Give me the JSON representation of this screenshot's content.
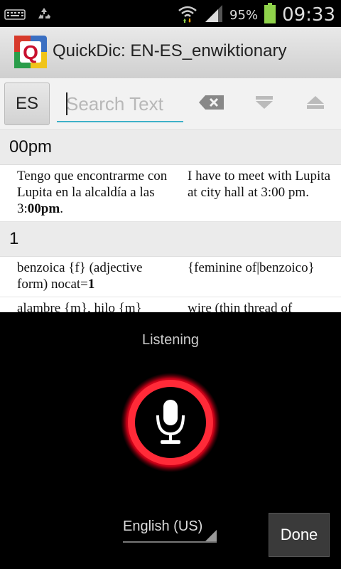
{
  "status_bar": {
    "battery_percent": "95%",
    "time": "09:33",
    "icons": [
      "keyboard-icon",
      "recycle-icon",
      "wifi-icon",
      "signal-icon",
      "battery-icon"
    ]
  },
  "title_bar": {
    "title": "QuickDic: EN-ES_enwiktionary",
    "app_icon_letter": "Q"
  },
  "toolbar": {
    "lang_button": "ES",
    "search_placeholder": "Search Text",
    "icons": [
      "backspace-icon",
      "arrow-down-icon",
      "arrow-up-icon"
    ]
  },
  "results": {
    "sections": [
      {
        "heading": "00pm",
        "entries": [
          {
            "left_pre": "Tengo que encontrarme con Lupita en la alcaldía a las 3:",
            "left_bold": "00pm",
            "left_post": ".",
            "right": "I have to meet with Lupita at city hall at 3:00 pm."
          }
        ]
      },
      {
        "heading": "1",
        "entries": [
          {
            "left_pre": "benzoica {f} (adjective form) nocat=",
            "left_bold": "1",
            "left_post": "",
            "right": "{feminine of|benzoico}"
          },
          {
            "left_pre": "alambre {m}, hilo {m}",
            "left_bold": "",
            "left_post": "",
            "right": "wire (thin thread of"
          }
        ]
      }
    ]
  },
  "voice_dialog": {
    "status": "Listening",
    "language": "English (US)",
    "done_label": "Done",
    "accent_color": "#e8001a"
  }
}
